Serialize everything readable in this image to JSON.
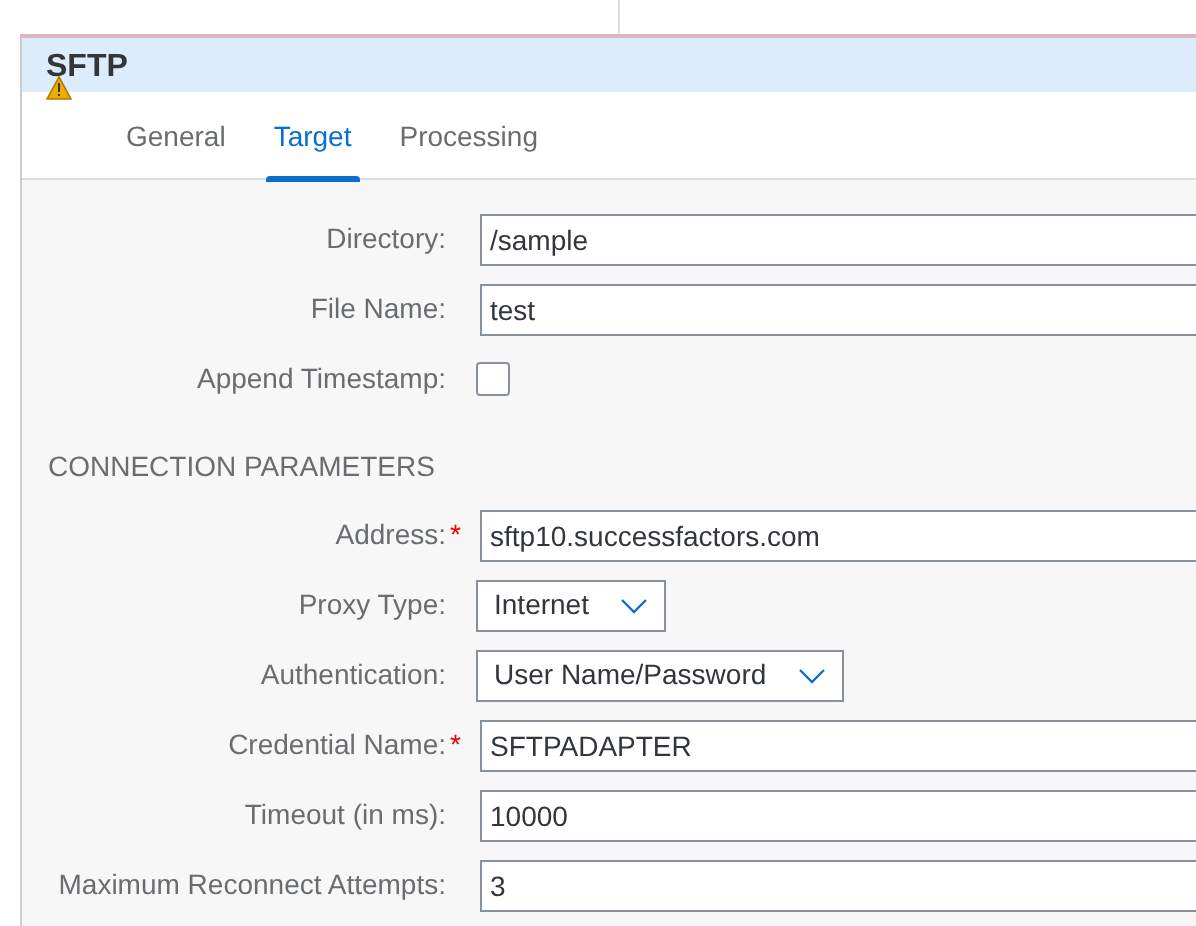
{
  "title": "SFTP",
  "warning": true,
  "tabs": [
    {
      "label": "General",
      "selected": false
    },
    {
      "label": "Target",
      "selected": true
    },
    {
      "label": "Processing",
      "selected": false
    }
  ],
  "sections": [
    {
      "fields": [
        {
          "kind": "text",
          "label": "Directory:",
          "value": "/sample"
        },
        {
          "kind": "text",
          "label": "File Name:",
          "value": "test"
        },
        {
          "kind": "checkbox",
          "label": "Append Timestamp:",
          "checked": false
        }
      ]
    },
    {
      "heading": "CONNECTION PARAMETERS",
      "fields": [
        {
          "kind": "text",
          "label": "Address:",
          "required_mark": "*",
          "value": "sftp10.successfactors.com"
        },
        {
          "kind": "select",
          "label": "Proxy Type:",
          "value": "Internet"
        },
        {
          "kind": "select",
          "label": "Authentication:",
          "value": "User Name/Password"
        },
        {
          "kind": "text",
          "label": "Credential Name:",
          "required_mark": "*",
          "value": "SFTPADAPTER"
        },
        {
          "kind": "text",
          "label": "Timeout (in ms):",
          "value": "10000"
        },
        {
          "kind": "text",
          "label": "Maximum Reconnect Attempts:",
          "value": "3"
        }
      ]
    }
  ]
}
